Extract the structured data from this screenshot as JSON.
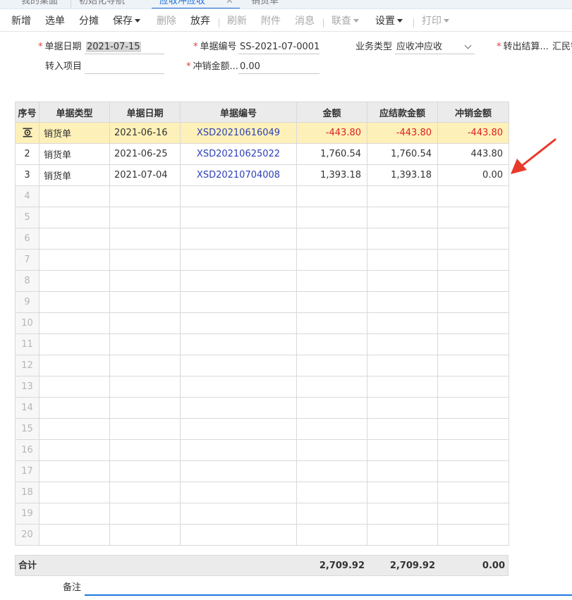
{
  "tabs": [
    {
      "label": "我的桌面"
    },
    {
      "label": "初始化导航"
    },
    {
      "label": "应收冲应收"
    },
    {
      "label": "销货单"
    }
  ],
  "tab_close": "✕",
  "toolbar": {
    "new": "新增",
    "select": "选单",
    "allocate": "分摊",
    "save": "保存",
    "delete": "删除",
    "discard": "放弃",
    "refresh": "刷新",
    "attach": "附件",
    "message": "消息",
    "linked": "联查",
    "settings": "设置",
    "print": "打印"
  },
  "form": {
    "doc_date_label": "单据日期",
    "doc_date_value": "2021-07-15",
    "doc_no_label": "单据编号",
    "doc_no_value": "SS-2021-07-0001",
    "biz_type_label": "业务类型",
    "biz_type_value": "应收冲应收",
    "transfer_out_label": "转出结算...",
    "transfer_out_value": "汇民销",
    "transfer_project_label": "转入项目",
    "transfer_project_value": "",
    "offset_amount_label": "冲销金额...",
    "offset_amount_value": "0.00"
  },
  "table": {
    "headers": [
      "序号",
      "单据类型",
      "单据日期",
      "单据编号",
      "金额",
      "应结款金额",
      "冲销金额"
    ],
    "rows": [
      {
        "idx": "1",
        "type": "销货单",
        "date": "2021-06-16",
        "no": "XSD20210616049",
        "amount": "-443.80",
        "due": "-443.80",
        "offset": "-443.80"
      },
      {
        "idx": "2",
        "type": "销货单",
        "date": "2021-06-25",
        "no": "XSD20210625022",
        "amount": "1,760.54",
        "due": "1,760.54",
        "offset": "443.80"
      },
      {
        "idx": "3",
        "type": "销货单",
        "date": "2021-07-04",
        "no": "XSD20210704008",
        "amount": "1,393.18",
        "due": "1,393.18",
        "offset": "0.00"
      }
    ],
    "empty_rows": [
      "4",
      "5",
      "6",
      "7",
      "8",
      "9",
      "10",
      "11",
      "12",
      "13",
      "14",
      "15",
      "16",
      "17",
      "18",
      "19",
      "20"
    ]
  },
  "totals": {
    "label": "合计",
    "amount": "2,709.92",
    "due": "2,709.92",
    "offset": "0.00"
  },
  "remark_label": "备注",
  "colors": {
    "accent": "#1e6fd9",
    "negative": "#e02020",
    "link": "#2c3fb8",
    "selected_row": "#fdf0b8",
    "arrow": "#e83a2a"
  }
}
